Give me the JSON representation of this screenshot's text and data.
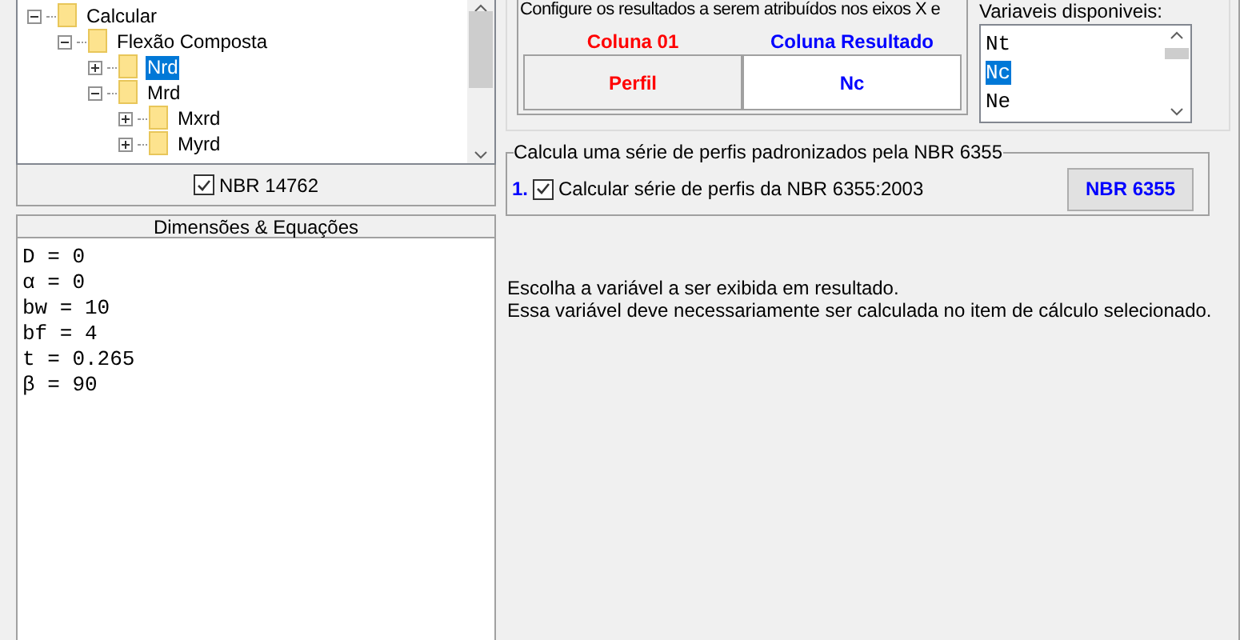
{
  "tree": [
    {
      "label": "Calcular",
      "expanded": true,
      "selected": false,
      "children": [
        {
          "label": "Flexão Composta",
          "expanded": true,
          "selected": false,
          "children": [
            {
              "label": "Nrd",
              "expanded": false,
              "selected": true
            },
            {
              "label": "Mrd",
              "expanded": true,
              "selected": false,
              "children": [
                {
                  "label": "Mxrd",
                  "expanded": false,
                  "selected": false
                },
                {
                  "label": "Myrd",
                  "expanded": false,
                  "selected": false
                }
              ]
            }
          ]
        }
      ]
    }
  ],
  "norm_checkbox": {
    "label": "NBR 14762",
    "checked": true
  },
  "equations": {
    "title": "Dimensões & Equações",
    "lines": [
      "D = 0",
      "α = 0",
      "bw = 10",
      "bf = 4",
      "t = 0.265",
      "β = 90"
    ]
  },
  "axes_group": {
    "title": "Configure os resultados a serem atribuídos nos eixos X e",
    "columns": [
      {
        "heading": "Coluna 01",
        "value": "Perfil",
        "color": "#ff0000"
      },
      {
        "heading": "Coluna Resultado",
        "value": "Nc",
        "color": "#0000ff"
      }
    ]
  },
  "variables": {
    "label": "Variaveis disponiveis:",
    "items": [
      {
        "label": "Nt",
        "selected": false
      },
      {
        "label": "Nc",
        "selected": true
      },
      {
        "label": "Ne",
        "selected": false
      }
    ]
  },
  "series_group": {
    "title": "Calcula uma série de perfis padronizados pela NBR 6355",
    "number": "1.",
    "checkbox": {
      "label": "Calcular série de perfis da NBR 6355:2003",
      "checked": true
    },
    "button": "NBR 6355"
  },
  "hint": [
    "Escolha a variável a ser exibida em resultado.",
    "Essa variável deve necessariamente ser calculada no item de cálculo selecionado."
  ]
}
